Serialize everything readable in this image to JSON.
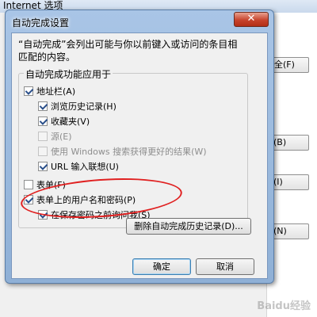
{
  "parent_window": {
    "title": "Internet 选项",
    "buttons": [
      "安全(F)",
      "(B)",
      "(I)",
      "(N)"
    ]
  },
  "dialog": {
    "title": "自动完成设置",
    "close_glyph": "✕",
    "description_lines": [
      "“自动完成”会列出可能与你以前键入或访问的条目相",
      "匹配的内容。"
    ],
    "group_label": "自动完成功能应用于",
    "options": {
      "address_bar": {
        "label": "地址栏(A)",
        "checked": true
      },
      "browse_history": {
        "label": "浏览历史记录(H)",
        "checked": true
      },
      "favorites": {
        "label": "收藏夹(V)",
        "checked": true
      },
      "feeds": {
        "label": "源(E)",
        "checked": false,
        "disabled": true
      },
      "windows_search": {
        "label": "使用 Windows 搜索获得更好的结果(W)",
        "checked": false,
        "disabled": true
      },
      "url_suggestions": {
        "label": "URL 输入联想(U)",
        "checked": true
      },
      "forms": {
        "label": "表单(F)",
        "checked": false
      },
      "form_passwords": {
        "label": "表单上的用户名和密码(P)",
        "checked": true
      },
      "ask_before_save": {
        "label": "在保存密码之前询问我(S)",
        "checked": true
      }
    },
    "delete_history_button": "删除自动完成历史记录(D)...",
    "ok_button": "确定",
    "cancel_button": "取消"
  },
  "watermark": "Baidu经验",
  "annotation_color": "#e02020"
}
